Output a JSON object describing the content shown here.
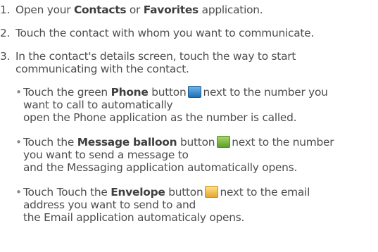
{
  "steps": [
    {
      "number": "1.",
      "prefix": "Open your",
      "bold1": "Contacts",
      "middle": "or",
      "bold2": "Favorites",
      "suffix": "application."
    },
    {
      "number": "2.",
      "text": "Touch the contact with whom you want to communicate."
    },
    {
      "number": "3.",
      "line1": "In the contact's details screen, touch the way to start",
      "line2": "communicating with the contact."
    }
  ],
  "bullets": [
    {
      "bullet": "•",
      "prefix": "Touch the green",
      "bold": "Phone",
      "middle": "button",
      "icon": "phone-icon",
      "after_icon": "next to the number you",
      "line2": "want to call to automatically",
      "line3": "open the Phone application as the number is called."
    },
    {
      "bullet": "•",
      "prefix": "Touch the",
      "bold": "Message balloon",
      "middle": "button",
      "icon": "message-balloon-icon",
      "after_icon": "next to the number",
      "line2": "you want to send a message to",
      "line3": "and the Messaging application automatically opens."
    },
    {
      "bullet": "•",
      "prefix": "Touch Touch the",
      "bold": "Envelope",
      "middle": "button",
      "icon": "envelope-icon",
      "after_icon": "next to the email",
      "line2": "address you want to send to and",
      "line3": "the Email application automaticaly opens."
    }
  ]
}
